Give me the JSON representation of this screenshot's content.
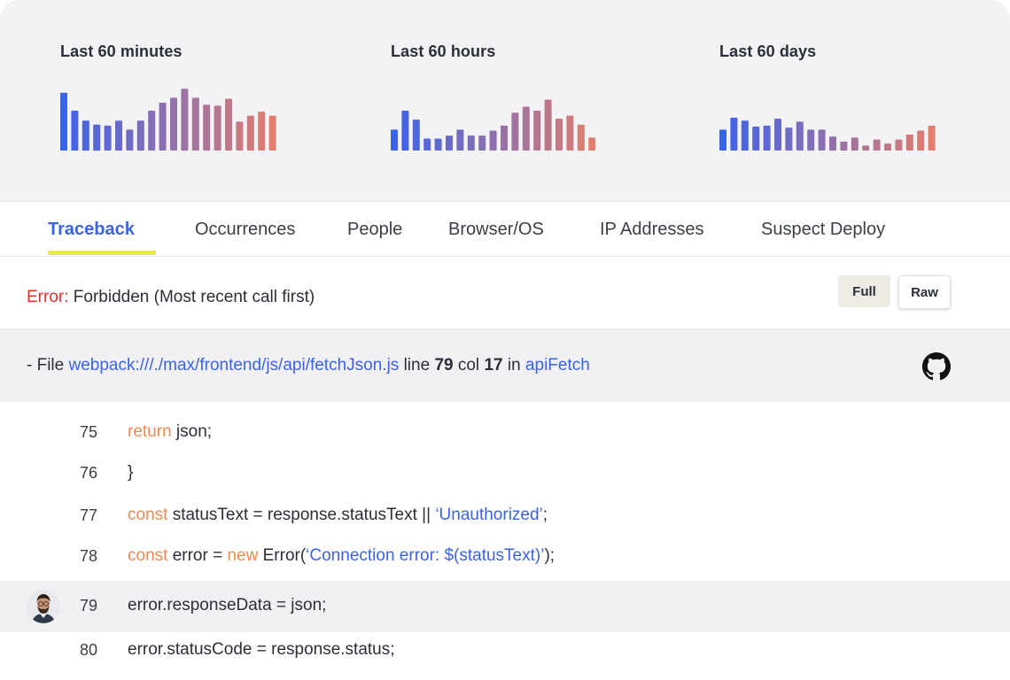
{
  "sparklines": [
    {
      "title": "Last 60 minutes",
      "values": [
        58,
        40,
        30,
        26,
        25,
        30,
        21,
        30,
        40,
        48,
        53,
        62,
        53,
        46,
        45,
        52,
        29,
        35,
        39,
        35
      ],
      "color_start": "#3b63ea",
      "color_end": "#e27d6f"
    },
    {
      "title": "Last 60 hours",
      "values": [
        21,
        40,
        31,
        12,
        12,
        15,
        21,
        15,
        15,
        20,
        25,
        38,
        44,
        40,
        51,
        32,
        35,
        26,
        13
      ],
      "color_start": "#3b63ea",
      "color_end": "#e27d6f"
    },
    {
      "title": "Last 60 days",
      "values": [
        21,
        33,
        30,
        24,
        25,
        32,
        23,
        29,
        21,
        21,
        14,
        9,
        13,
        5,
        11,
        7,
        11,
        16,
        20,
        25
      ],
      "color_start": "#3b63ea",
      "color_end": "#e27d6f"
    }
  ],
  "tabs": [
    {
      "label": "Traceback",
      "active": true
    },
    {
      "label": "Occurrences"
    },
    {
      "label": "People"
    },
    {
      "label": "Browser/OS"
    },
    {
      "label": "IP Addresses"
    },
    {
      "label": "Suspect Deploy"
    }
  ],
  "error": {
    "label": "Error:",
    "message": " Forbidden (Most recent call first)"
  },
  "buttons": {
    "full": "Full",
    "raw": "Raw"
  },
  "file": {
    "prefix": "- File ",
    "path": "webpack:///./max/frontend/js/api/fetchJson.js",
    "line_word": " line ",
    "line": "79",
    "col_word": " col ",
    "col": "17",
    "in_word": " in ",
    "function": "apiFetch"
  },
  "code": [
    {
      "line": "75",
      "parts": [
        {
          "t": "return",
          "c": "kw"
        },
        {
          "t": " json;",
          "c": ""
        }
      ]
    },
    {
      "line": "76",
      "parts": [
        {
          "t": "}",
          "c": ""
        }
      ]
    },
    {
      "line": "77",
      "parts": [
        {
          "t": "const",
          "c": "kw"
        },
        {
          "t": " statusText = response.statusText || ",
          "c": ""
        },
        {
          "t": "‘Unauthorized’",
          "c": "str"
        },
        {
          "t": ";",
          "c": ""
        }
      ]
    },
    {
      "line": "78",
      "parts": [
        {
          "t": "const",
          "c": "kw"
        },
        {
          "t": " error = ",
          "c": ""
        },
        {
          "t": "new",
          "c": "kw"
        },
        {
          "t": " Error(",
          "c": ""
        },
        {
          "t": "‘Connection error: $(statusText)’",
          "c": "str"
        },
        {
          "t": ");",
          "c": ""
        }
      ]
    },
    {
      "line": "79",
      "highlight": true,
      "avatar": true,
      "parts": [
        {
          "t": "error.responseData = json;",
          "c": ""
        }
      ]
    },
    {
      "line": "80",
      "parts": [
        {
          "t": "error.statusCode = response.status;",
          "c": ""
        }
      ]
    }
  ],
  "icons": {
    "repo": "github-icon",
    "avatar": "user-avatar"
  }
}
